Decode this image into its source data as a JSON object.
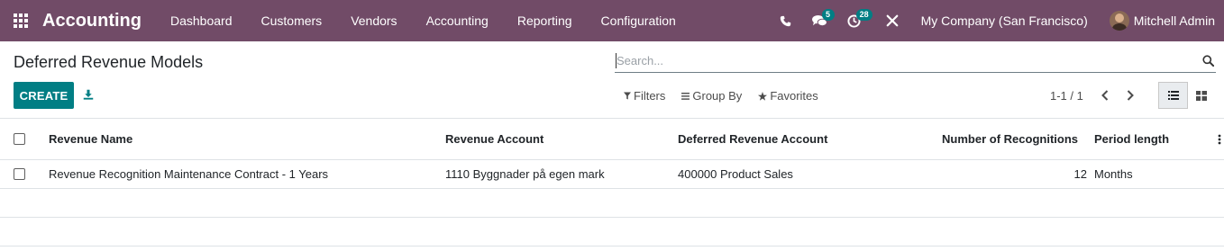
{
  "navbar": {
    "app_name": "Accounting",
    "menu": [
      "Dashboard",
      "Customers",
      "Vendors",
      "Accounting",
      "Reporting",
      "Configuration"
    ],
    "messages_count": "5",
    "activities_count": "28",
    "company": "My Company (San Francisco)",
    "user": "Mitchell Admin",
    "bg_color": "#714B67"
  },
  "control_panel": {
    "breadcrumb": "Deferred Revenue Models",
    "search_placeholder": "Search...",
    "create_label": "CREATE",
    "filters_label": "Filters",
    "group_by_label": "Group By",
    "favorites_label": "Favorites",
    "pager": "1-1 / 1",
    "accent_color": "#017e84"
  },
  "table": {
    "columns": [
      "Revenue Name",
      "Revenue Account",
      "Deferred Revenue Account",
      "Number of Recognitions",
      "Period length"
    ],
    "rows": [
      [
        "Revenue Recognition Maintenance Contract - 1 Years",
        "1110 Byggnader på egen mark",
        "400000 Product Sales",
        "12",
        "Months"
      ]
    ]
  },
  "icons": {
    "apps": "apps-grid-icon",
    "phone": "phone-icon",
    "chat": "chat-icon",
    "activity": "clock-icon",
    "tools": "tools-icon",
    "search": "search-icon",
    "download": "download-icon",
    "filter": "filter-icon",
    "group": "group-by-icon",
    "star": "star-icon",
    "prev": "chevron-left-icon",
    "next": "chevron-right-icon",
    "list": "list-view-icon",
    "kanban": "kanban-view-icon",
    "optional": "optional-columns-icon"
  }
}
